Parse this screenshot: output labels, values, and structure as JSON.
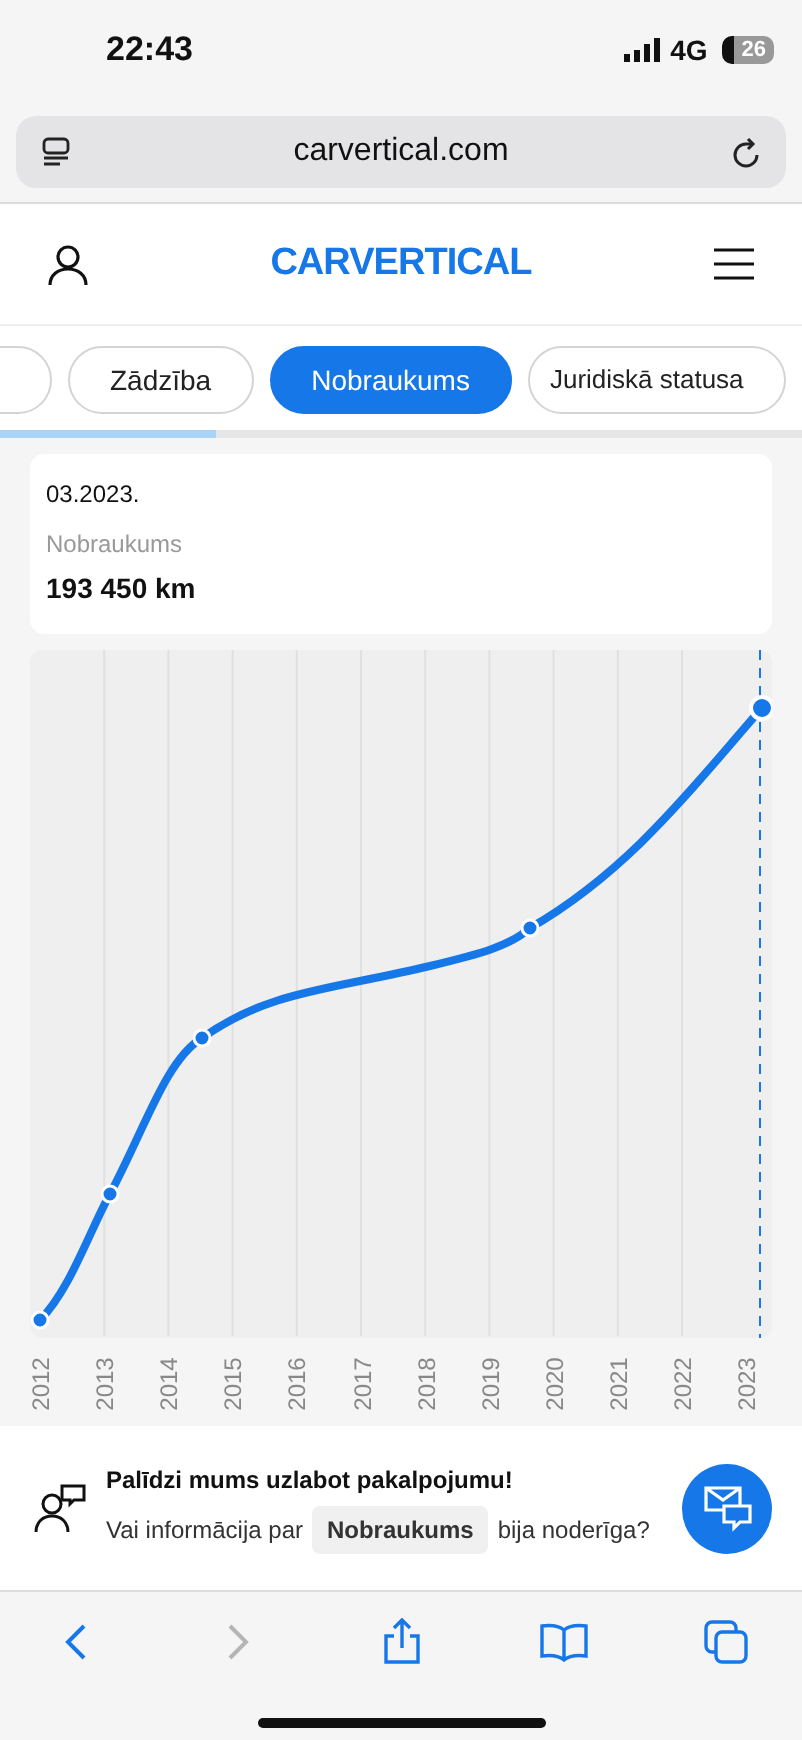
{
  "status_bar": {
    "time": "22:43",
    "network": "4G",
    "battery": "26"
  },
  "browser": {
    "url": "carvertical.com"
  },
  "header": {
    "logo": "CARVERTICAL"
  },
  "tabs": [
    {
      "selected": false
    },
    {
      "label": "Zādzība",
      "selected": false
    },
    {
      "label": "Nobraukums",
      "selected": true
    },
    {
      "label": "Juridiskā statusa",
      "selected": false
    }
  ],
  "progress": {
    "level": 0.27
  },
  "summary": {
    "date": "03.2023.",
    "label": "Nobraukums",
    "value": "193 450 km"
  },
  "chart": {
    "x_labels": [
      "2012",
      "2013",
      "2014",
      "2015",
      "2016",
      "2017",
      "2018",
      "2019",
      "2020",
      "2021",
      "2022",
      "2023"
    ]
  },
  "feedback": {
    "title": "Palīdzi mums uzlabot pakalpojumu!",
    "question_start": "Vai informācija par",
    "chip": "Nobraukums",
    "question_end": "bija noderīga?"
  },
  "toolbar": [
    {
      "kind": "back",
      "disabled": false
    },
    {
      "kind": "forward",
      "disabled": true
    },
    {
      "kind": "share",
      "disabled": false
    },
    {
      "kind": "bookmarks",
      "disabled": false
    },
    {
      "kind": "tabs",
      "disabled": false
    }
  ]
}
